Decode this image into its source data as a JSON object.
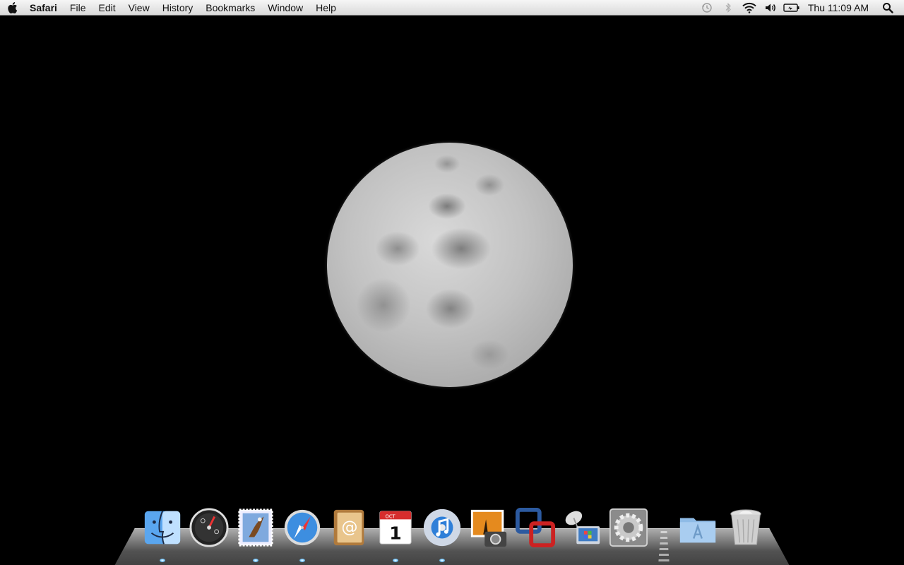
{
  "menubar": {
    "apple_icon": "apple-logo-icon",
    "app_name": "Safari",
    "menus": [
      "File",
      "Edit",
      "View",
      "History",
      "Bookmarks",
      "Window",
      "Help"
    ],
    "status": {
      "time_machine_icon": "time-machine-icon",
      "bluetooth_icon": "bluetooth-icon",
      "wifi_icon": "wifi-icon",
      "volume_icon": "volume-icon",
      "battery_icon": "battery-charging-icon",
      "clock": "Thu 11:09 AM",
      "spotlight_icon": "spotlight-search-icon"
    }
  },
  "desktop": {
    "wallpaper": "full-moon",
    "background_color": "#000000"
  },
  "dock": {
    "items": [
      {
        "name": "finder",
        "icon": "finder-icon",
        "running": true
      },
      {
        "name": "dashboard",
        "icon": "dashboard-icon",
        "running": false
      },
      {
        "name": "mail",
        "icon": "mail-icon",
        "running": true
      },
      {
        "name": "safari",
        "icon": "safari-icon",
        "running": true
      },
      {
        "name": "address-book",
        "icon": "address-book-icon",
        "running": false
      },
      {
        "name": "ical",
        "icon": "ical-icon",
        "running": true,
        "month": "OCT",
        "day": "1"
      },
      {
        "name": "itunes",
        "icon": "itunes-icon",
        "running": true
      },
      {
        "name": "iphoto",
        "icon": "iphoto-icon",
        "running": false
      },
      {
        "name": "vmware-fusion",
        "icon": "vmware-fusion-icon",
        "running": false
      },
      {
        "name": "remote-desktop",
        "icon": "remote-desktop-icon",
        "running": false
      },
      {
        "name": "system-preferences",
        "icon": "system-preferences-icon",
        "running": false
      },
      {
        "name": "applications-folder",
        "icon": "applications-folder-icon",
        "running": false
      },
      {
        "name": "trash",
        "icon": "trash-icon",
        "running": false
      }
    ]
  }
}
